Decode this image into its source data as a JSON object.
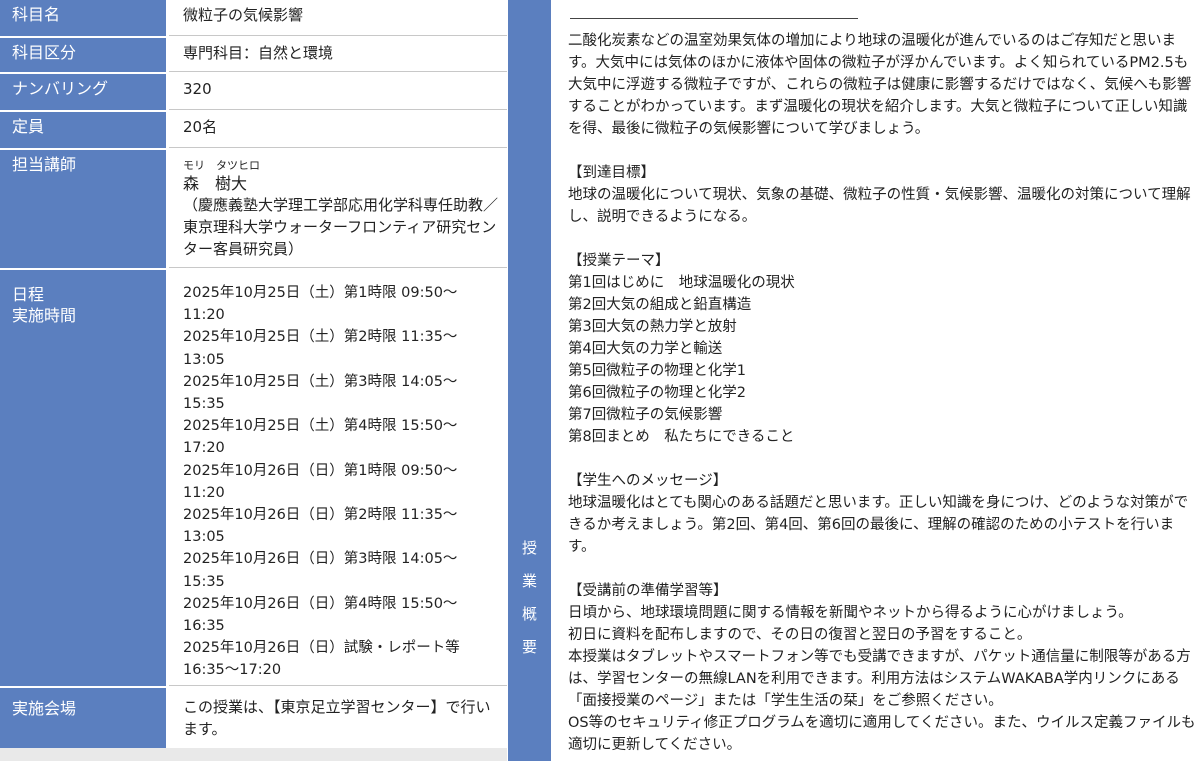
{
  "left_table": {
    "rows": [
      {
        "label": "科目名",
        "value": "微粒子の気候影響"
      },
      {
        "label": "科目区分",
        "value": "専門科目：自然と環境"
      },
      {
        "label": "ナンバリング",
        "value": "320"
      },
      {
        "label": "定員",
        "value": "20名"
      },
      {
        "label": "担当講師",
        "furigana": "モリ　タツヒロ",
        "name": "森　樹大",
        "affiliation": "（慶應義塾大学理工学部応用化学科専任助教／東京理科大学ウォーターフロンティア研究センター客員研究員）"
      },
      {
        "label_line1": "日程",
        "label_line2": "実施時間"
      },
      {
        "label": "実施会場",
        "value": "この授業は、【東京足立学習センター】で行います。"
      }
    ],
    "schedule": [
      "2025年10月25日（土）第1時限 09:50～11:20",
      "2025年10月25日（土）第2時限 11:35～13:05",
      "2025年10月25日（土）第3時限 14:05～15:35",
      "2025年10月25日（土）第4時限 15:50～17:20",
      "2025年10月26日（日）第1時限 09:50～11:20",
      "2025年10月26日（日）第2時限 11:35～13:05",
      "2025年10月26日（日）第3時限 14:05～15:35",
      "2025年10月26日（日）第4時限 15:50～16:35",
      "2025年10月26日（日）試験・レポート等 16:35～17:20"
    ]
  },
  "vertical_label": [
    "授",
    "業",
    "概",
    "要"
  ],
  "overview": {
    "intro": "二酸化炭素などの温室効果気体の増加により地球の温暖化が進んでいるのはご存知だと思います。大気中には気体のほかに液体や固体の微粒子が浮かんでいます。よく知られているPM2.5も大気中に浮遊する微粒子ですが、これらの微粒子は健康に影響するだけではなく、気候へも影響することがわかっています。まず温暖化の現状を紹介します。大気と微粒子について正しい知識を得、最後に微粒子の気候影響について学びましょう。",
    "goals_heading": "【到達目標】",
    "goals": "地球の温暖化について現状、気象の基礎、微粒子の性質・気候影響、温暖化の対策について理解し、説明できるようになる。",
    "themes_heading": "【授業テーマ】",
    "themes": [
      "第1回はじめに　地球温暖化の現状",
      "第2回大気の組成と鉛直構造",
      "第3回大気の熱力学と放射",
      "第4回大気の力学と輸送",
      "第5回微粒子の物理と化学1",
      "第6回微粒子の物理と化学2",
      "第7回微粒子の気候影響",
      "第8回まとめ　私たちにできること"
    ],
    "message_heading": "【学生へのメッセージ】",
    "message": "地球温暖化はとても関心のある話題だと思います。正しい知識を身につけ、どのような対策ができるか考えましょう。第2回、第4回、第6回の最後に、理解の確認のための小テストを行います。",
    "prep_heading": "【受講前の準備学習等】",
    "prep_lines": [
      "日頃から、地球環境問題に関する情報を新聞やネットから得るように心がけましょう。",
      "初日に資料を配布しますので、その日の復習と翌日の予習をすること。",
      "本授業はタブレットやスマートフォン等でも受講できますが、パケット通信量に制限等がある方は、学習センターの無線LANを利用できます。利用方法はシステムWAKABA学内リンクにある「面接授業のページ」または「学生生活の栞」をご参照ください。",
      "OS等のセキュリティ修正プログラムを適切に適用してください。また、ウイルス定義ファイルも適切に更新してください。"
    ]
  }
}
